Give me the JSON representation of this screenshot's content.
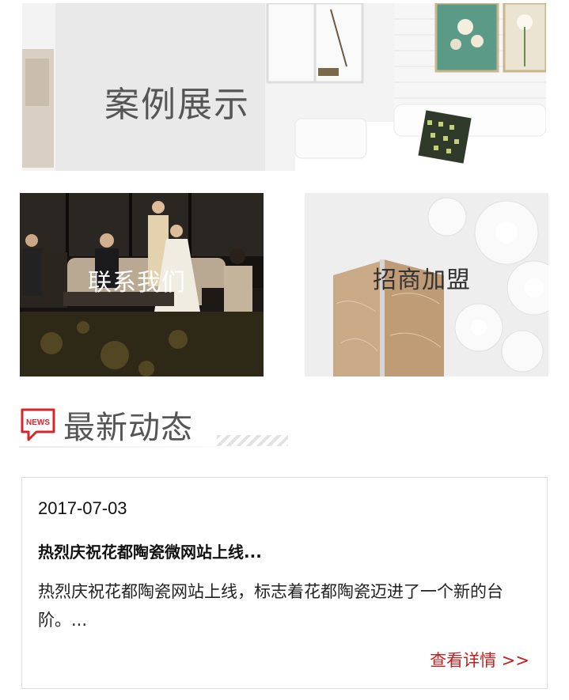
{
  "banner": {
    "title": "案例展示"
  },
  "tiles": {
    "contact_label": "联系我们",
    "franchise_label": "招商加盟"
  },
  "section": {
    "icon_text": "NEWS",
    "title": "最新动态"
  },
  "news": {
    "date": "2017-07-03",
    "title": "热烈庆祝花都陶瓷微网站上线...",
    "summary": "热烈庆祝花都陶瓷网站上线，标志着花都陶瓷迈进了一个新的台阶。...",
    "more_label": "查看详情 >>"
  },
  "colors": {
    "accent_red": "#c02020",
    "icon_red": "#d6262b"
  }
}
